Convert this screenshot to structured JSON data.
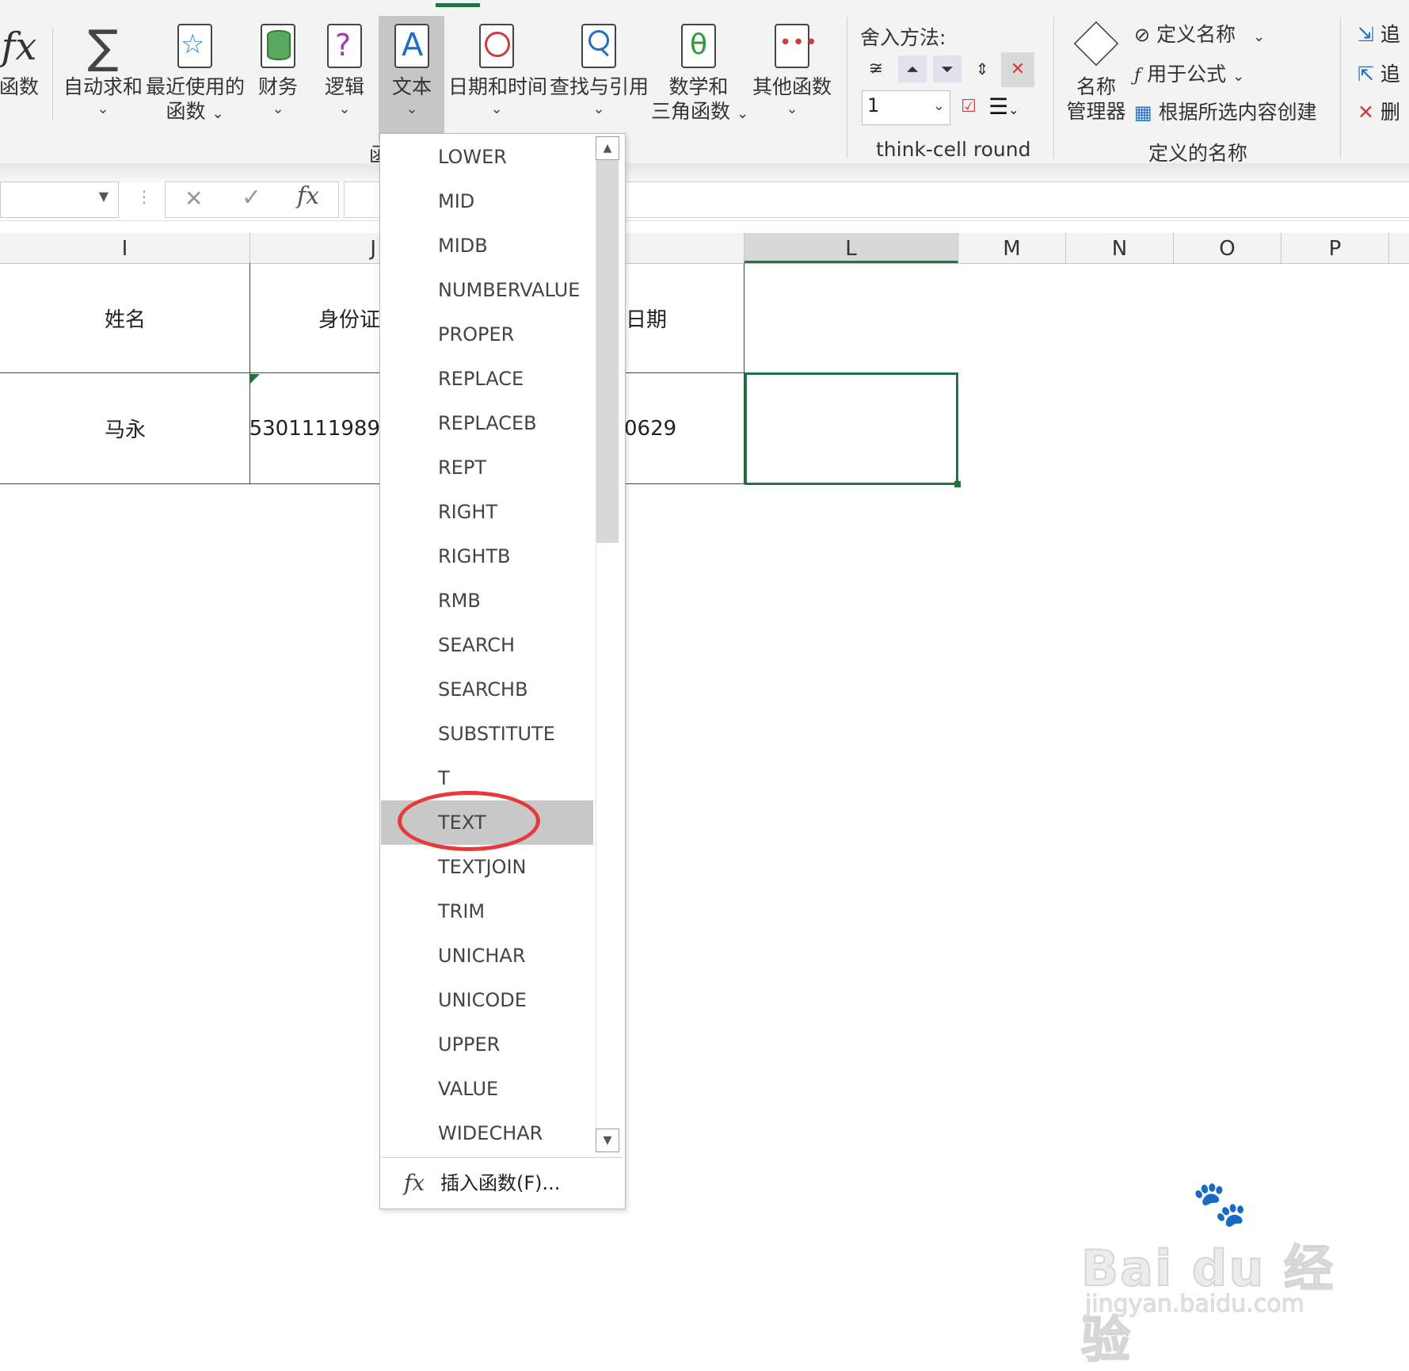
{
  "ribbon": {
    "insert_function_label": "函数",
    "autosum_label": "自动求和",
    "recent_label_1": "最近使用的",
    "recent_label_2": "函数",
    "financial_label": "财务",
    "logical_label": "逻辑",
    "text_label": "文本",
    "datetime_label": "日期和时间",
    "lookup_label": "查找与引用",
    "math_label_1": "数学和",
    "math_label_2": "三角函数",
    "more_label": "其他函数",
    "group_label_partial": "函",
    "thinkcell": {
      "rounding_label": "舍入方法:",
      "precision_value": "1",
      "group_label": "think-cell round"
    },
    "defined_names": {
      "name_manager_1": "名称",
      "name_manager_2": "管理器",
      "define_name": "定义名称",
      "use_in_formula": "用于公式",
      "create_from_selection": "根据所选内容创建",
      "group_label": "定义的名称"
    },
    "audit": {
      "trace_precedents": "追",
      "trace_dependents": "追",
      "remove_arrows": "删"
    }
  },
  "formula_bar": {
    "fx_symbol": "fx",
    "cancel_symbol": "✕",
    "enter_symbol": "✓"
  },
  "grid": {
    "columns": [
      "I",
      "J",
      "L",
      "M",
      "N",
      "O",
      "P"
    ],
    "header_row": {
      "I": "姓名",
      "J_partial": "身份证",
      "K_partial": "日期"
    },
    "data_row": {
      "I": "马永",
      "J_partial": "5301111989",
      "K_partial": "0629"
    }
  },
  "dropdown": {
    "items": [
      "LOWER",
      "MID",
      "MIDB",
      "NUMBERVALUE",
      "PROPER",
      "REPLACE",
      "REPLACEB",
      "REPT",
      "RIGHT",
      "RIGHTB",
      "RMB",
      "SEARCH",
      "SEARCHB",
      "SUBSTITUTE",
      "T",
      "TEXT",
      "TEXTJOIN",
      "TRIM",
      "UNICHAR",
      "UNICODE",
      "UPPER",
      "VALUE",
      "WIDECHAR"
    ],
    "highlighted": "TEXT",
    "insert_function": "插入函数(F)..."
  },
  "watermark": {
    "brand": "Bai du 经验",
    "url": "jingyan.baidu.com"
  },
  "colors": {
    "accent_green": "#217346",
    "highlight_circle": "#e8393a",
    "hover_gray": "#c8c8c8"
  }
}
